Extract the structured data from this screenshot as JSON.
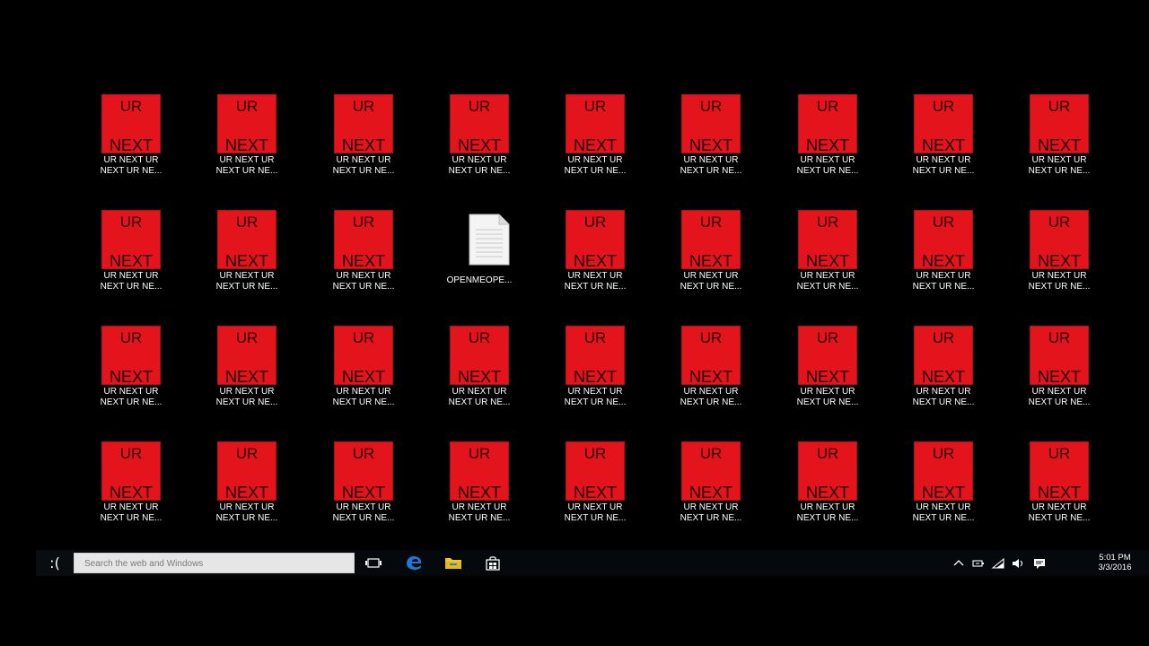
{
  "desktop": {
    "tile_top_text": "UR",
    "tile_bottom_text": "NEXT",
    "ur_icon_caption": "UR NEXT UR NEXT UR NE...",
    "file_icon_caption": "OPENMEOPE...",
    "grid": [
      [
        "ur",
        "ur",
        "ur",
        "ur",
        "ur",
        "ur",
        "ur",
        "ur",
        "ur"
      ],
      [
        "ur",
        "ur",
        "ur",
        "file",
        "ur",
        "ur",
        "ur",
        "ur",
        "ur"
      ],
      [
        "ur",
        "ur",
        "ur",
        "ur",
        "ur",
        "ur",
        "ur",
        "ur",
        "ur"
      ],
      [
        "ur",
        "ur",
        "ur",
        "ur",
        "ur",
        "ur",
        "ur",
        "ur",
        "ur"
      ]
    ],
    "colors": {
      "background": "#000000",
      "tile_red": "#e3141b",
      "caption_text": "#ffffff"
    }
  },
  "taskbar": {
    "start_label": ":(",
    "search_placeholder": "Search the web and Windows",
    "buttons": [
      {
        "name": "task-view-icon"
      },
      {
        "name": "edge-browser-icon"
      },
      {
        "name": "file-explorer-icon"
      },
      {
        "name": "store-icon"
      }
    ],
    "tray": {
      "icons": [
        "chevron-up-icon",
        "battery-icon",
        "wifi-icon",
        "volume-icon",
        "notification-icon"
      ],
      "time": "5:01 PM",
      "date": "3/3/2016"
    },
    "colors": {
      "background": "#05080c",
      "edge_blue": "#1e78d4",
      "folder_yellow": "#f3c623"
    }
  }
}
